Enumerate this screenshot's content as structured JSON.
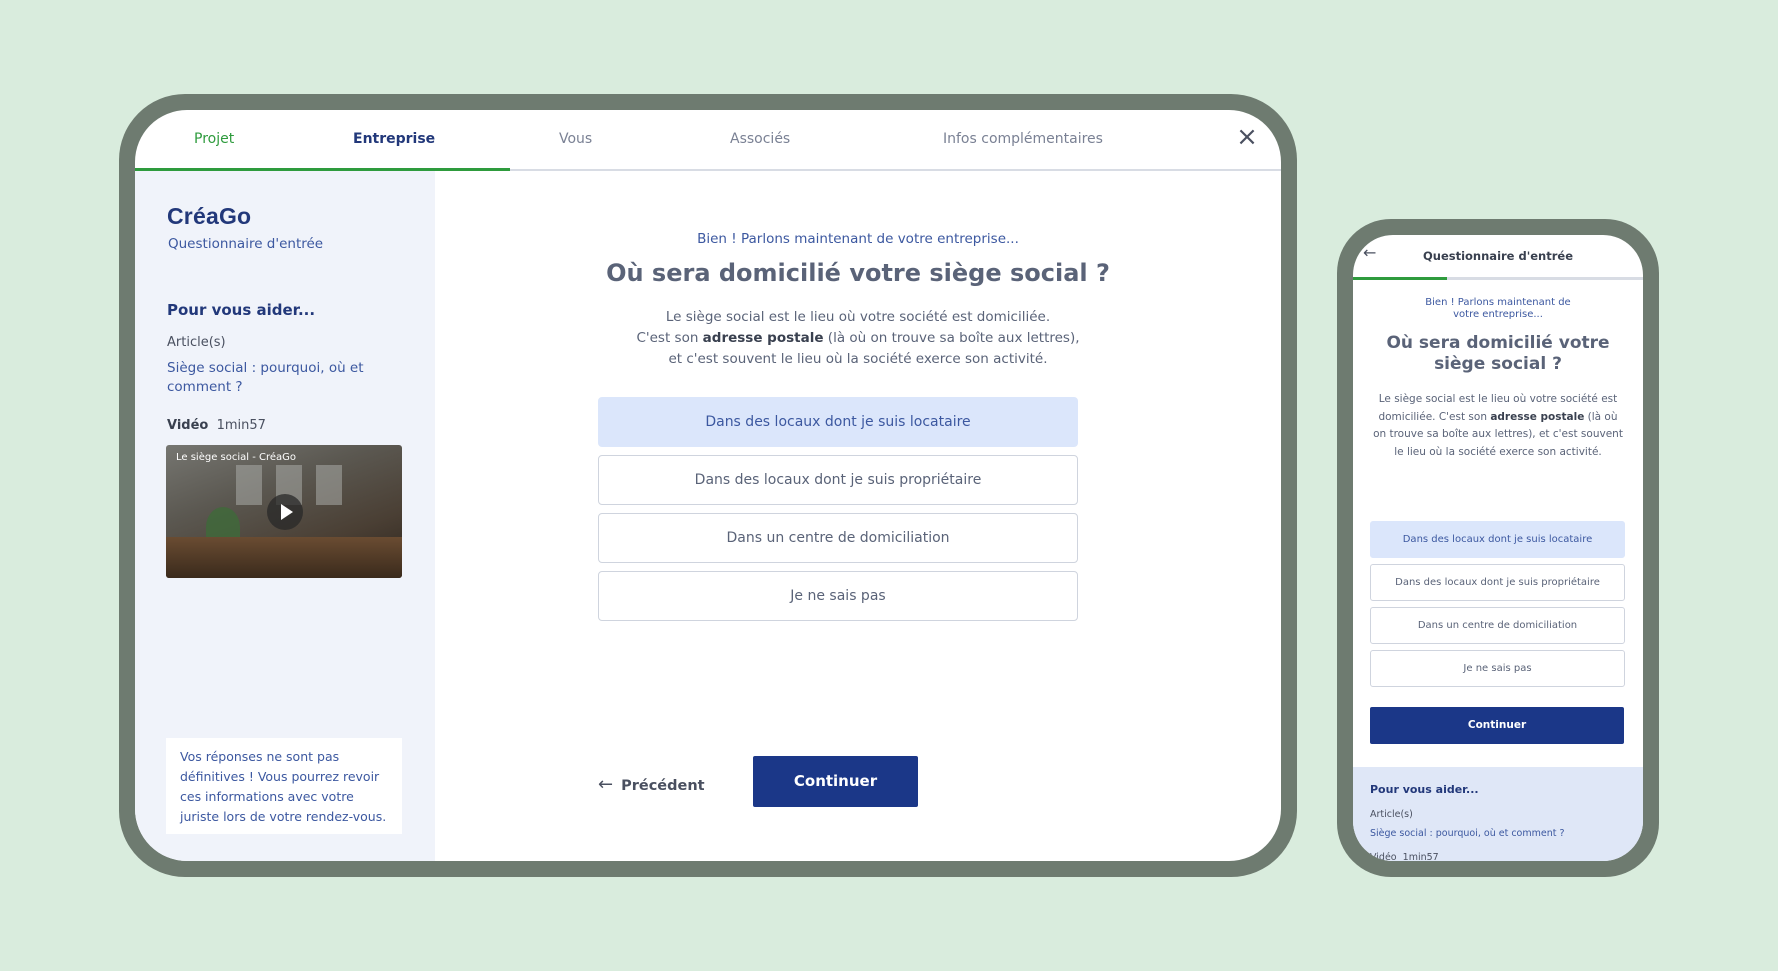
{
  "tablet": {
    "tabs": [
      {
        "label": "Projet",
        "state": "done"
      },
      {
        "label": "Entreprise",
        "state": "active"
      },
      {
        "label": "Vous",
        "state": "upcoming"
      },
      {
        "label": "Associés",
        "state": "upcoming"
      },
      {
        "label": "Infos complémentaires",
        "state": "upcoming"
      }
    ],
    "close_icon": "×",
    "sidebar": {
      "brand": "CréaGo",
      "subtitle": "Questionnaire d'entrée",
      "help_title": "Pour vous aider...",
      "articles_label": "Article(s)",
      "article_link": "Siège social : pourquoi, où et comment ?",
      "video_label": "Vidéo",
      "video_duration": "1min57",
      "video_title": "Le siège social - CréaGo",
      "note": "Vos réponses ne sont pas définitives ! Vous pourrez revoir ces informations avec votre juriste lors de votre rendez-vous."
    },
    "main": {
      "intro": "Bien ! Parlons maintenant de votre entreprise...",
      "question": "Où sera domicilié votre siège social ?",
      "desc_line1": "Le siège social est le lieu où votre société est domiciliée.",
      "desc_line2_pre": "C'est son ",
      "desc_line2_bold": "adresse postale",
      "desc_line2_post": " (là où on trouve sa boîte aux lettres),",
      "desc_line3": "et c'est souvent le lieu où la société exerce son activité.",
      "options": [
        "Dans des locaux dont je suis locataire",
        "Dans des locaux dont je suis propriétaire",
        "Dans un centre de domiciliation",
        "Je ne sais pas"
      ],
      "selected_option": 0,
      "back_label": "Précédent",
      "continue_label": "Continuer"
    }
  },
  "phone": {
    "header_title": "Questionnaire d'entrée",
    "intro": "Bien ! Parlons maintenant de votre entreprise...",
    "question": "Où sera domicilié votre siège social ?",
    "desc_pre": "Le siège social est le lieu où votre société est domiciliée. C'est son ",
    "desc_bold": "adresse postale",
    "desc_post": " (là où on trouve sa boîte aux lettres), et c'est souvent le lieu où la société exerce son activité.",
    "options": [
      "Dans des locaux dont je suis locataire",
      "Dans des locaux dont je suis propriétaire",
      "Dans un centre de domiciliation",
      "Je ne sais pas"
    ],
    "continue_label": "Continuer",
    "help_title": "Pour vous aider...",
    "articles_label": "Article(s)",
    "article_link": "Siège social : pourquoi, où et comment ?",
    "video_label": "Vidéo",
    "video_duration": "1min57"
  },
  "colors": {
    "background": "#d9ecdd",
    "frame": "#6e7b70",
    "primary": "#1b3788",
    "progress": "#2e9b3d",
    "selected_option": "#dbe6fb"
  }
}
